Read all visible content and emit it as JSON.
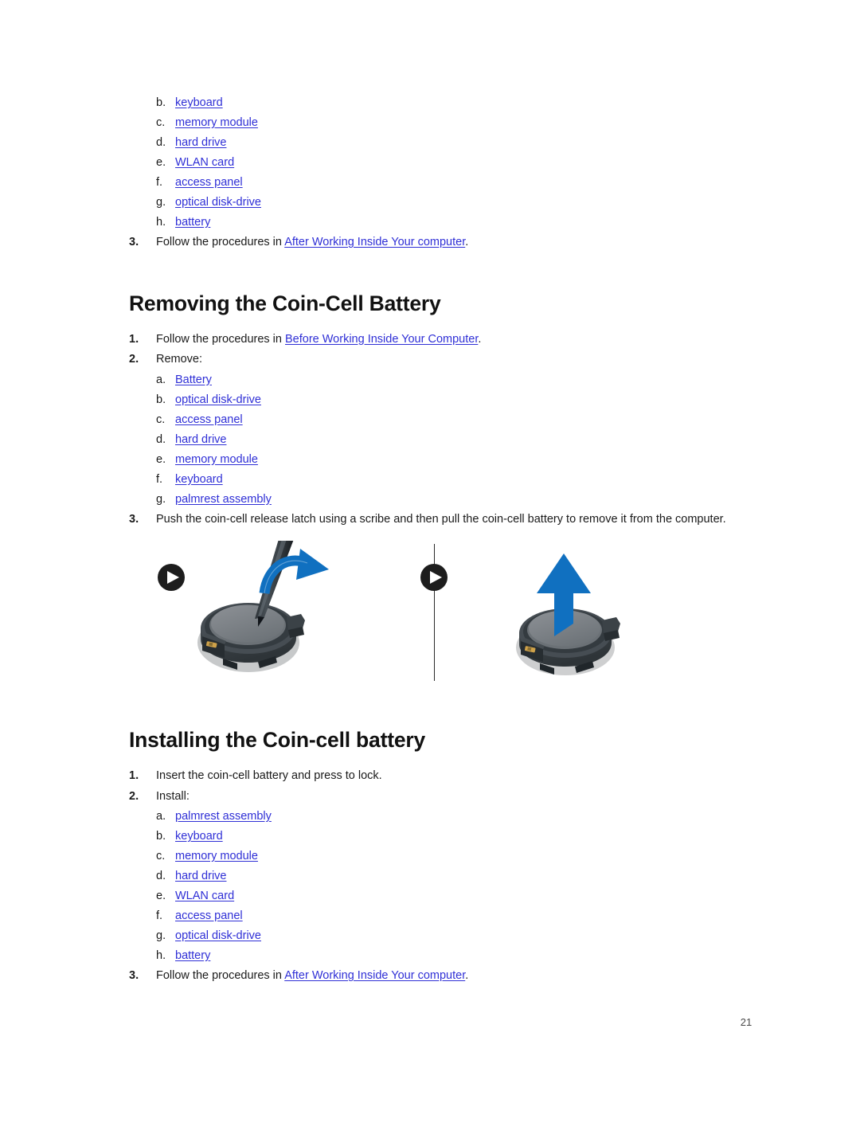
{
  "document": {
    "page_number": "21",
    "link_color": "#2f2fd6",
    "arrow_color": "#1070c0",
    "text_color": "#1a1a1a"
  },
  "top_section": {
    "sub_items": [
      {
        "marker": "b.",
        "label": "keyboard",
        "link": true
      },
      {
        "marker": "c.",
        "label": "memory module",
        "link": true
      },
      {
        "marker": "d.",
        "label": "hard drive",
        "link": true
      },
      {
        "marker": "e.",
        "label": "WLAN card",
        "link": true
      },
      {
        "marker": "f.",
        "label": "access panel",
        "link": true
      },
      {
        "marker": "g.",
        "label": "optical disk-drive",
        "link": true
      },
      {
        "marker": "h.",
        "label": "battery",
        "link": true
      }
    ],
    "step3": {
      "number": "3.",
      "text_before": "Follow the procedures in ",
      "link": "After Working Inside Your computer",
      "text_after": "."
    }
  },
  "removing_section": {
    "heading": "Removing the Coin-Cell Battery",
    "step1": {
      "number": "1.",
      "text_before": "Follow the procedures in ",
      "link": "Before Working Inside Your Computer",
      "text_after": "."
    },
    "step2": {
      "number": "2.",
      "text": "Remove:"
    },
    "sub_items": [
      {
        "marker": "a.",
        "label": "Battery",
        "link": true
      },
      {
        "marker": "b.",
        "label": "optical disk-drive",
        "link": true
      },
      {
        "marker": "c.",
        "label": "access panel",
        "link": true
      },
      {
        "marker": "d.",
        "label": "hard drive",
        "link": true
      },
      {
        "marker": "e.",
        "label": "memory module",
        "link": true
      },
      {
        "marker": "f.",
        "label": "keyboard",
        "link": true
      },
      {
        "marker": "g.",
        "label": "palmrest assembly",
        "link": true
      }
    ],
    "step3": {
      "number": "3.",
      "text": "Push the coin-cell release latch using a scribe and then pull the coin-cell battery to remove it from the computer."
    }
  },
  "figure": {
    "panel_a_alt": "Coin-cell battery being released with a scribe, curved blue arrow",
    "panel_b_alt": "Coin-cell battery lifted out, straight blue arrow pointing up"
  },
  "installing_section": {
    "heading": "Installing the Coin-cell battery",
    "step1": {
      "number": "1.",
      "text": "Insert the coin-cell battery and press to lock."
    },
    "step2": {
      "number": "2.",
      "text": "Install:"
    },
    "sub_items": [
      {
        "marker": "a.",
        "label": "palmrest assembly",
        "link": true
      },
      {
        "marker": "b.",
        "label": "keyboard",
        "link": true
      },
      {
        "marker": "c.",
        "label": "memory module",
        "link": true
      },
      {
        "marker": "d.",
        "label": "hard drive",
        "link": true
      },
      {
        "marker": "e.",
        "label": "WLAN card",
        "link": true
      },
      {
        "marker": "f.",
        "label": "access panel",
        "link": true
      },
      {
        "marker": "g.",
        "label": "optical disk-drive",
        "link": true
      },
      {
        "marker": "h.",
        "label": "battery",
        "link": true
      }
    ],
    "step3": {
      "number": "3.",
      "text_before": "Follow the procedures in ",
      "link": "After Working Inside Your computer",
      "text_after": "."
    }
  }
}
